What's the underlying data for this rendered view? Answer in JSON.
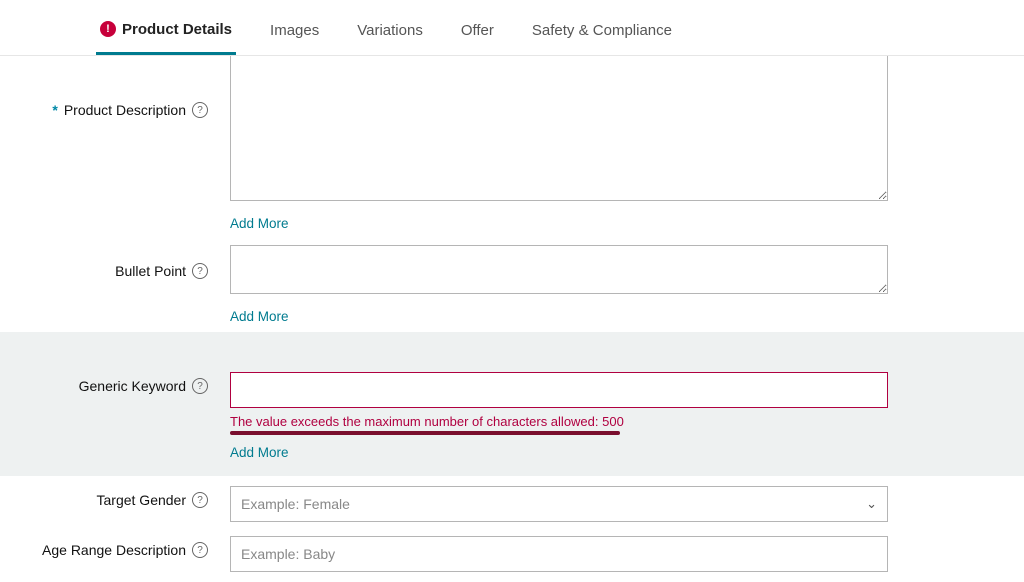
{
  "tabs": {
    "product_details": "Product Details",
    "images": "Images",
    "variations": "Variations",
    "offer": "Offer",
    "safety": "Safety & Compliance"
  },
  "labels": {
    "product_description": "Product Description",
    "bullet_point": "Bullet Point",
    "generic_keyword": "Generic Keyword",
    "target_gender": "Target Gender",
    "age_range_description": "Age Range Description"
  },
  "values": {
    "product_description": "",
    "bullet_point": "",
    "generic_keyword": "",
    "target_gender": "",
    "age_range_description": ""
  },
  "placeholders": {
    "target_gender": "Example: Female",
    "age_range_description": "Example: Baby"
  },
  "actions": {
    "add_more": "Add More"
  },
  "errors": {
    "generic_keyword": "The value exceeds the maximum number of characters allowed: 500"
  },
  "icons": {
    "help": "?",
    "error": "!",
    "chevron_down": "⌄"
  }
}
